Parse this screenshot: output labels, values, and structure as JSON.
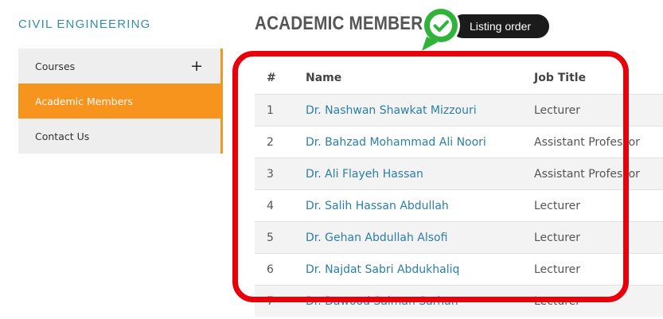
{
  "sidebar": {
    "department_title": "CIVIL ENGINEERING",
    "items": [
      {
        "label": "Courses",
        "expand_symbol": "+"
      },
      {
        "label": "Academic Members"
      },
      {
        "label": "Contact Us"
      }
    ],
    "accent_color": "#f7941d"
  },
  "main": {
    "page_title": "ACADEMIC MEMBERS",
    "table": {
      "headers": {
        "num": "#",
        "name": "Name",
        "job": "Job Title"
      },
      "rows": [
        {
          "num": "1",
          "name": "Dr. Nashwan Shawkat Mizzouri",
          "job": "Lecturer"
        },
        {
          "num": "2",
          "name": "Dr. Bahzad Mohammad Ali Noori",
          "job": "Assistant Professor"
        },
        {
          "num": "3",
          "name": "Dr. Ali Flayeh Hassan",
          "job": "Assistant Professor"
        },
        {
          "num": "4",
          "name": "Dr. Salih Hassan Abdullah",
          "job": "Lecturer"
        },
        {
          "num": "5",
          "name": "Dr. Gehan Abdullah Alsofi",
          "job": "Lecturer"
        },
        {
          "num": "6",
          "name": "Dr. Najdat Sabri Abdukhaliq",
          "job": "Lecturer"
        },
        {
          "num": "7",
          "name": "Dr. Dawood Salman Sarhan",
          "job": "Lecturer"
        }
      ]
    },
    "link_color": "#2a7fa6"
  },
  "annotation": {
    "tooltip_text": "Listing order",
    "check_icon": "check-pin-icon",
    "box_color": "#e8000b",
    "pin_color": "#2fb33a"
  }
}
